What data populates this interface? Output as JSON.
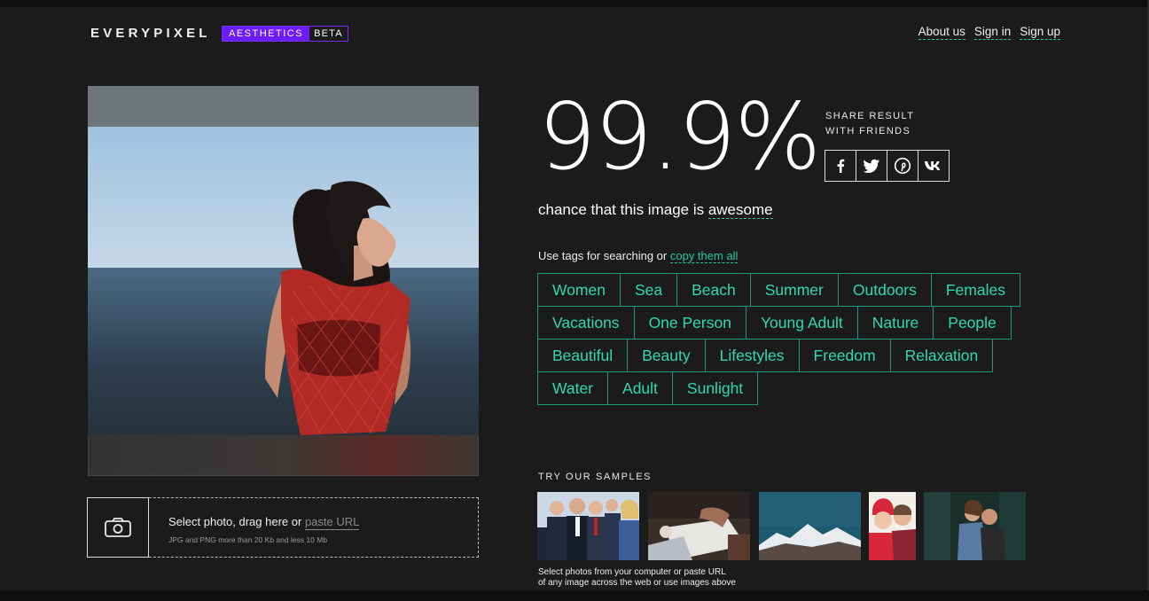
{
  "header": {
    "logo": "EVERYPIXEL",
    "badge_primary": "AESTHETICS",
    "badge_secondary": "BETA",
    "nav": [
      {
        "label": "About us"
      },
      {
        "label": "Sign in"
      },
      {
        "label": "Sign up"
      }
    ]
  },
  "result": {
    "score": "99.9%",
    "caption_prefix": "chance that this image is ",
    "caption_word": "awesome"
  },
  "share": {
    "line1": "SHARE RESULT",
    "line2": "WITH FRIENDS",
    "icons": [
      "facebook-icon",
      "twitter-icon",
      "pinterest-icon",
      "vk-icon"
    ]
  },
  "tags": {
    "intro": "Use tags for searching or ",
    "copy_link": "copy them all",
    "rows": [
      [
        "Women",
        "Sea",
        "Beach",
        "Summer",
        "Outdoors",
        "Females"
      ],
      [
        "Vacations",
        "One Person",
        "Young Adult",
        "Nature",
        "People"
      ],
      [
        "Beautiful",
        "Beauty",
        "Lifestyles",
        "Freedom",
        "Relaxation"
      ],
      [
        "Water",
        "Adult",
        "Sunlight"
      ]
    ]
  },
  "upload": {
    "prompt": "Select photo, drag here or ",
    "url_placeholder": "paste URL",
    "hint": "JPG and PNG more than 20 Kb and less 10 Mb"
  },
  "samples": {
    "label": "TRY OUR SAMPLES",
    "hint_line1": "Select photos from your computer or paste URL",
    "hint_line2": "of any image across the web or use images above"
  },
  "colors": {
    "accent": "#1fc7a3",
    "badge": "#6f1bff",
    "background": "#1b1b1b"
  }
}
